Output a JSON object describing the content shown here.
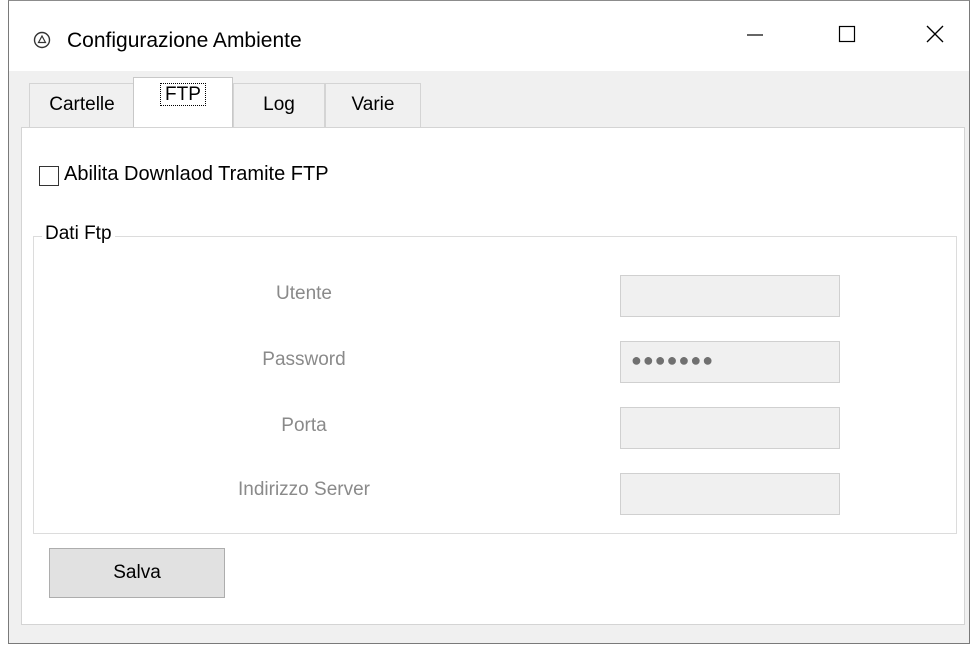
{
  "window": {
    "title": "Configurazione Ambiente"
  },
  "tabs": [
    {
      "label": "Cartelle"
    },
    {
      "label": "FTP"
    },
    {
      "label": "Log"
    },
    {
      "label": "Varie"
    }
  ],
  "active_tab": "FTP",
  "ftp": {
    "enable_checkbox": {
      "label": "Abilita Downlaod  Tramite FTP",
      "checked": false
    },
    "group_title": "Dati Ftp",
    "fields": [
      {
        "label": "Utente",
        "value": "",
        "enabled": false
      },
      {
        "label": "Password",
        "value": "●●●●●●●",
        "enabled": false
      },
      {
        "label": "Porta",
        "value": "",
        "enabled": false
      },
      {
        "label": "Indirizzo Server",
        "value": "",
        "enabled": false
      }
    ],
    "save_label": "Salva"
  },
  "icons": {
    "app": "app-icon",
    "minimize": "minimize-icon",
    "maximize": "maximize-icon",
    "close": "close-icon"
  }
}
